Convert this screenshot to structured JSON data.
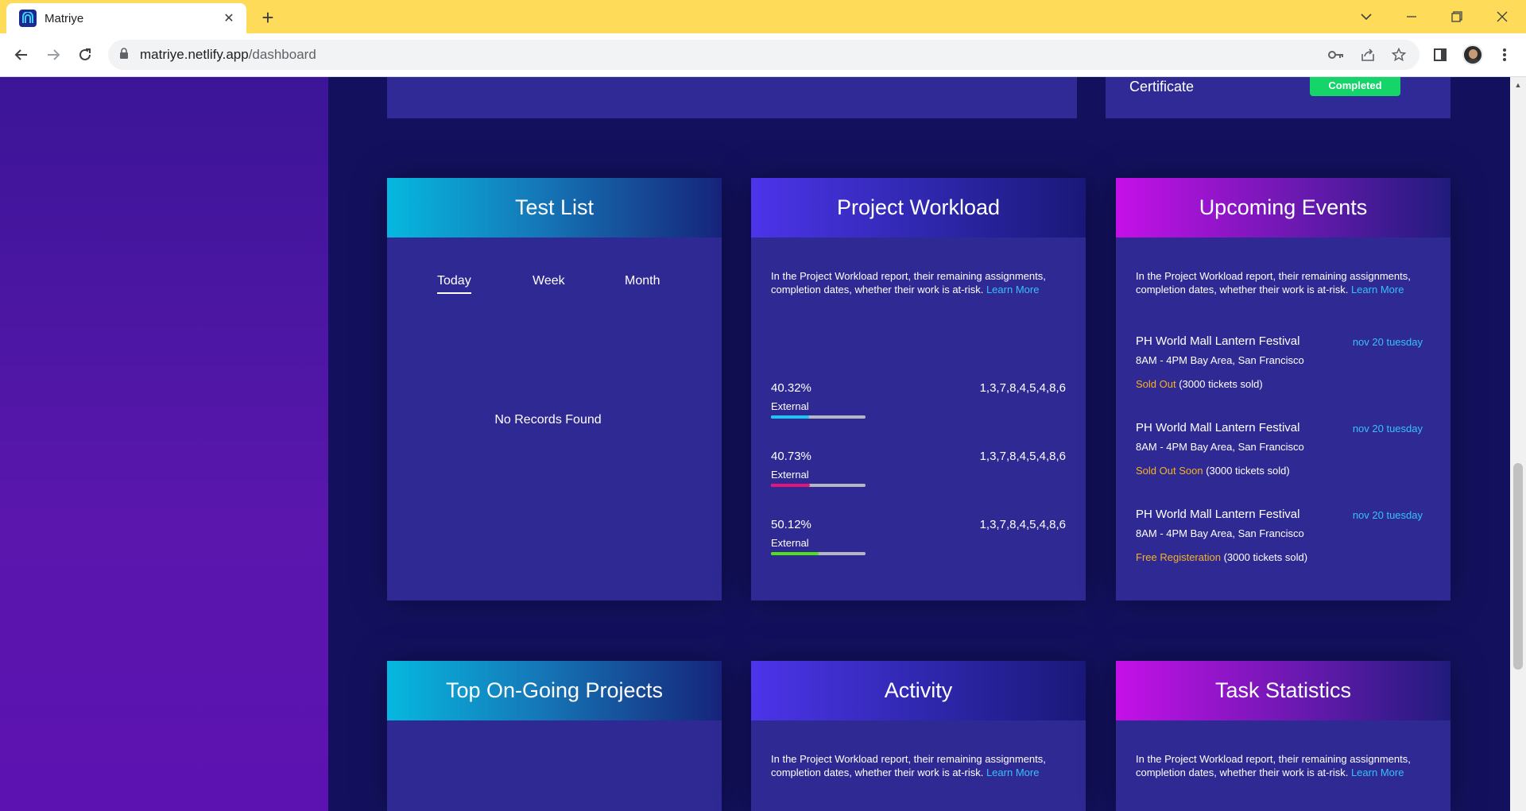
{
  "browser": {
    "tab_title": "Matriye",
    "url_host": "matriye.netlify.app",
    "url_path": "/dashboard"
  },
  "top_cards": {
    "certificate_label": "Certificate",
    "completed_badge": "Completed"
  },
  "test_list": {
    "title": "Test List",
    "tabs": [
      "Today",
      "Week",
      "Month"
    ],
    "active_tab": "Today",
    "empty_text": "No Records Found"
  },
  "project_workload": {
    "title": "Project Workload",
    "desc": "In the Project Workload report, their remaining assignments, completion dates, whether their work is at-risk.",
    "learn_more": "Learn More",
    "rows": [
      {
        "percent": "40.32%",
        "label": "External",
        "nums": "1,3,7,8,4,5,4,8,6",
        "progress": 0.4,
        "color": "#1cc8f2"
      },
      {
        "percent": "40.73%",
        "label": "External",
        "nums": "1,3,7,8,4,5,4,8,6",
        "progress": 0.41,
        "color": "#e2157b"
      },
      {
        "percent": "50.12%",
        "label": "External",
        "nums": "1,3,7,8,4,5,4,8,6",
        "progress": 0.5,
        "color": "#4fe316"
      }
    ]
  },
  "upcoming_events": {
    "title": "Upcoming Events",
    "desc": "In the Project Workload report, their remaining assignments, completion dates, whether their work is at-risk.",
    "learn_more": "Learn More",
    "events": [
      {
        "title": "PH World Mall Lantern Festival",
        "date": "nov 20 tuesday",
        "time": "8AM - 4PM Bay Area, San Francisco",
        "status": "Sold Out",
        "tickets": "(3000 tickets sold)"
      },
      {
        "title": "PH World Mall Lantern Festival",
        "date": "nov 20 tuesday",
        "time": "8AM - 4PM Bay Area, San Francisco",
        "status": "Sold Out Soon",
        "tickets": "(3000 tickets sold)"
      },
      {
        "title": "PH World Mall Lantern Festival",
        "date": "nov 20 tuesday",
        "time": "8AM - 4PM Bay Area, San Francisco",
        "status": "Free Registeration",
        "tickets": "(3000 tickets sold)"
      }
    ]
  },
  "top_projects": {
    "title": "Top On-Going Projects"
  },
  "activity": {
    "title": "Activity",
    "desc": "In the Project Workload report, their remaining assignments, completion dates, whether their work is at-risk.",
    "learn_more": "Learn More"
  },
  "task_statistics": {
    "title": "Task Statistics",
    "desc": "In the Project Workload report, their remaining assignments, completion dates, whether their work is at-risk.",
    "learn_more": "Learn More"
  },
  "icons": {
    "favicon": "matriye-logo-icon",
    "back": "back-arrow-icon",
    "forward": "forward-arrow-icon",
    "reload": "reload-icon",
    "lock": "lock-icon",
    "key": "key-icon",
    "share": "share-icon",
    "star": "star-icon",
    "sidepanel": "side-panel-icon",
    "menu": "kebab-menu-icon"
  }
}
